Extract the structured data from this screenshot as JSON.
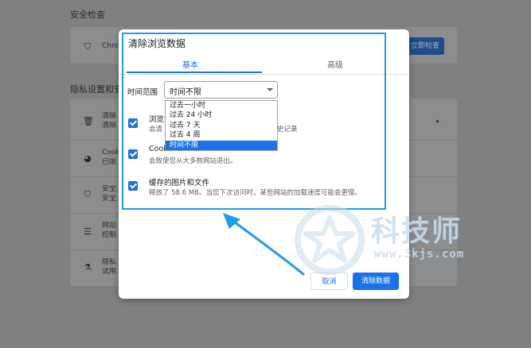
{
  "background": {
    "section_title": "安全检查",
    "safety_row_text": "Chro",
    "safety_button_label": "立即检查",
    "privacy_heading": "隐私设置和安",
    "rows": [
      {
        "text1": "清除",
        "text2": "清除"
      },
      {
        "text1": "Cook",
        "text2": "已阻"
      },
      {
        "text1": "安全",
        "text2": "安全"
      },
      {
        "text1": "网站",
        "text2": "控制"
      },
      {
        "text1": "隐私",
        "text2": "试用"
      }
    ]
  },
  "dialog": {
    "title": "清除浏览数据",
    "tabs": {
      "basic": "基本",
      "advanced": "高级"
    },
    "time_range": {
      "label": "时间范围",
      "value": "时间不限",
      "options": [
        "过去一小时",
        "过去 24 小时",
        "过去 7 天",
        "过去 4 周",
        "时间不限"
      ],
      "selected_index": 4
    },
    "items": [
      {
        "title": "浏览记",
        "desc": "会清",
        "desc_tail": "史记录",
        "checked": true
      },
      {
        "title": "Cooki",
        "desc": "会致使您从大多数网站退出。",
        "checked": true
      },
      {
        "title": "缓存的图片和文件",
        "desc": "释放了 58.6 MB。当您下次访问时，某些网站的加载速度可能会更慢。",
        "checked": true
      }
    ],
    "buttons": {
      "cancel": "取消",
      "clear": "清除数据"
    }
  },
  "watermark": {
    "brand": "科技师",
    "url": "www.3kjs.com"
  },
  "colors": {
    "accent": "#1a73e8",
    "annotation": "#1e9bf0"
  }
}
